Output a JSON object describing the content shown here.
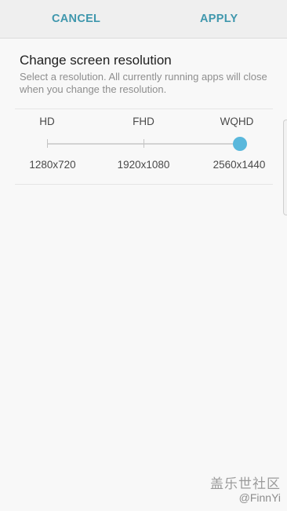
{
  "action_bar": {
    "cancel_label": "CANCEL",
    "apply_label": "APPLY"
  },
  "content": {
    "title": "Change screen resolution",
    "description": "Select a resolution. All currently running apps will close when you change the resolution."
  },
  "resolution_slider": {
    "options": [
      {
        "name": "HD",
        "value": "1280x720"
      },
      {
        "name": "FHD",
        "value": "1920x1080"
      },
      {
        "name": "WQHD",
        "value": "2560x1440"
      }
    ],
    "selected_index": 2,
    "accent_color": "#5ab8dc"
  },
  "watermark": {
    "site": "盖乐世社区",
    "user": "@FinnYi"
  },
  "colors": {
    "action_text": "#3f97ad",
    "background": "#f8f8f8"
  }
}
